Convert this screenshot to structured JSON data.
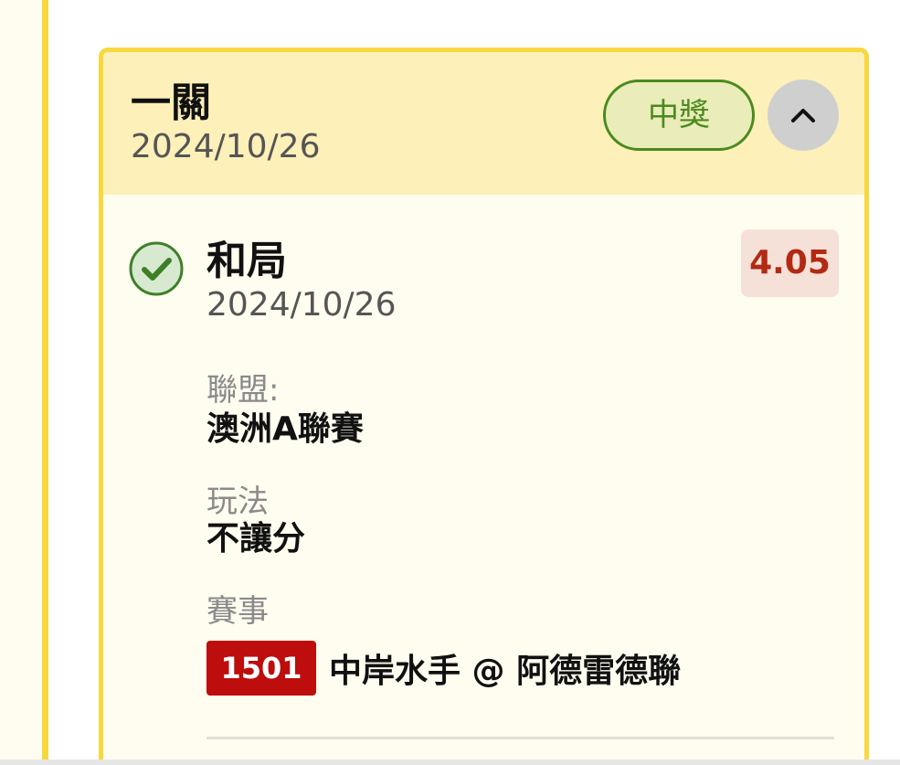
{
  "card": {
    "title": "一關",
    "date": "2024/10/26",
    "status": "中獎",
    "status_color": "#4b8a1e",
    "collapse_icon": "chevron-up-icon"
  },
  "selection": {
    "name": "和局",
    "date": "2024/10/26",
    "odds": "4.05",
    "odds_color": "#b22a13",
    "result_icon": "check-circle-icon",
    "league_label": "聯盟:",
    "league_value": "澳洲A聯賽",
    "bet_type_label": "玩法",
    "bet_type_value": "不讓分",
    "match_label": "賽事",
    "match_number": "1501",
    "match_name": "中岸水手 @ 阿德雷德聯"
  }
}
